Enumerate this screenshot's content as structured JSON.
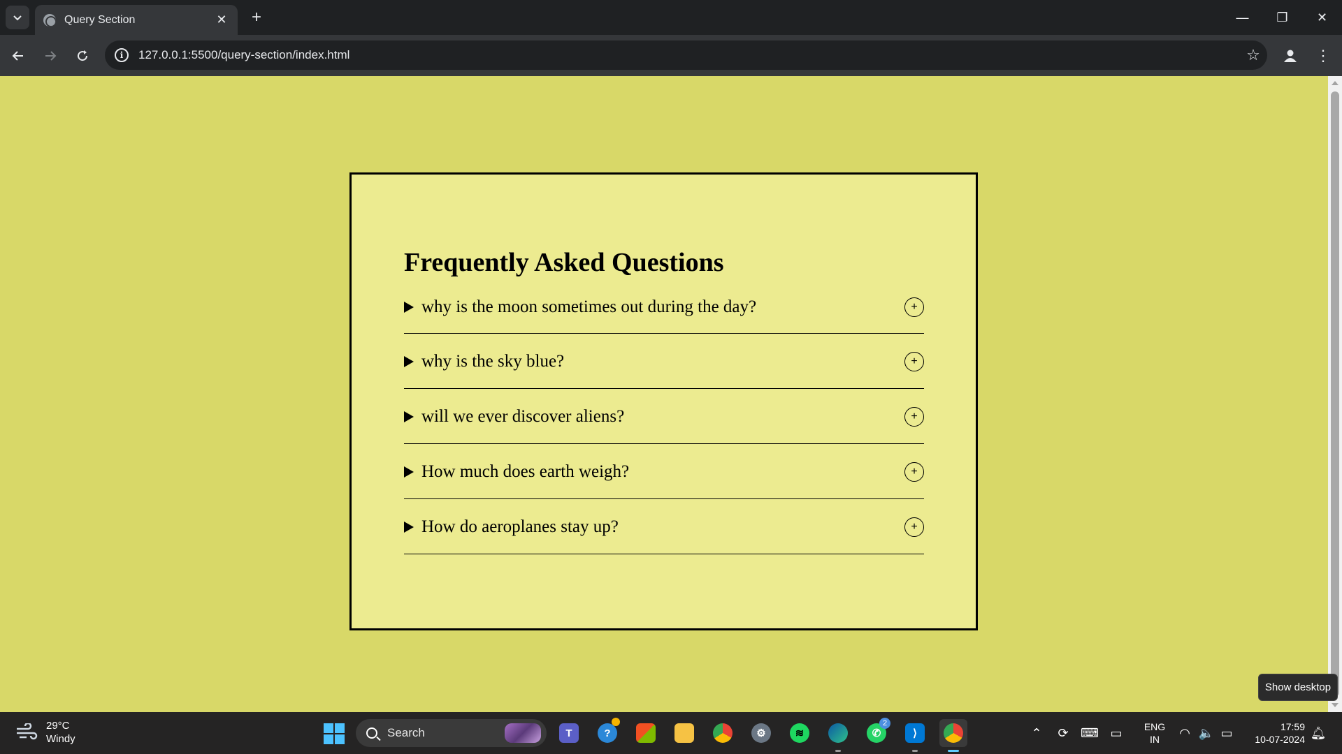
{
  "browser": {
    "tab_title": "Query Section",
    "url": "127.0.0.1:5500/query-section/index.html"
  },
  "faq": {
    "heading": "Frequently Asked Questions",
    "items": [
      {
        "question": "why is the moon sometimes out during the day?",
        "toggle": "+"
      },
      {
        "question": "why is the sky blue?",
        "toggle": "+"
      },
      {
        "question": "will we ever discover aliens?",
        "toggle": "+"
      },
      {
        "question": "How much does earth weigh?",
        "toggle": "+"
      },
      {
        "question": "How do aeroplanes stay up?",
        "toggle": "+"
      }
    ]
  },
  "taskbar": {
    "weather_temp": "29°C",
    "weather_desc": "Windy",
    "search_label": "Search",
    "whatsapp_badge": "2",
    "lang_line1": "ENG",
    "lang_line2": "IN",
    "time": "17:59",
    "date": "10-07-2024",
    "tooltip": "Show desktop"
  },
  "colors": {
    "page_bg": "#d8d868",
    "card_bg": "#eceb90",
    "chrome_dark": "#1f2123",
    "chrome_mid": "#35373a"
  }
}
